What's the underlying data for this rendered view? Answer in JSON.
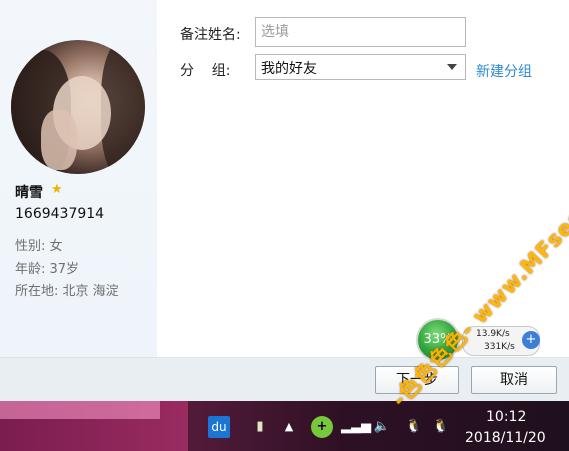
{
  "profile": {
    "nickname": "晴雪",
    "qq_number": "1669437914",
    "gender_line": "性别: 女",
    "age_line": "年龄: 37岁",
    "location_line": "所在地: 北京  海淀"
  },
  "form": {
    "remark_label": "备注姓名:",
    "remark_placeholder": "选填",
    "group_label": "分    组:",
    "group_value": "我的好友",
    "new_group_link": "新建分组"
  },
  "buttons": {
    "next": "下一步",
    "cancel": "取消"
  },
  "speed_widget": {
    "percent": "33%",
    "upload": "13.9K/s",
    "download": "331K/s"
  },
  "taskbar": {
    "time": "10:12",
    "date": "2018/11/20",
    "du_icon_text": "du"
  },
  "watermark": "-色色色色- www.MFsese.com",
  "icons": [
    "star-icon",
    "chevron-down-icon",
    "baidu-du-icon",
    "usb-icon",
    "arrow-up-icon",
    "green-plus-icon",
    "signal-icon",
    "volume-icon",
    "qq-penguin-icon"
  ],
  "colors": {
    "link": "#2d8bd4",
    "star": "#f0b400",
    "taskbar": "#7b1d4f"
  }
}
